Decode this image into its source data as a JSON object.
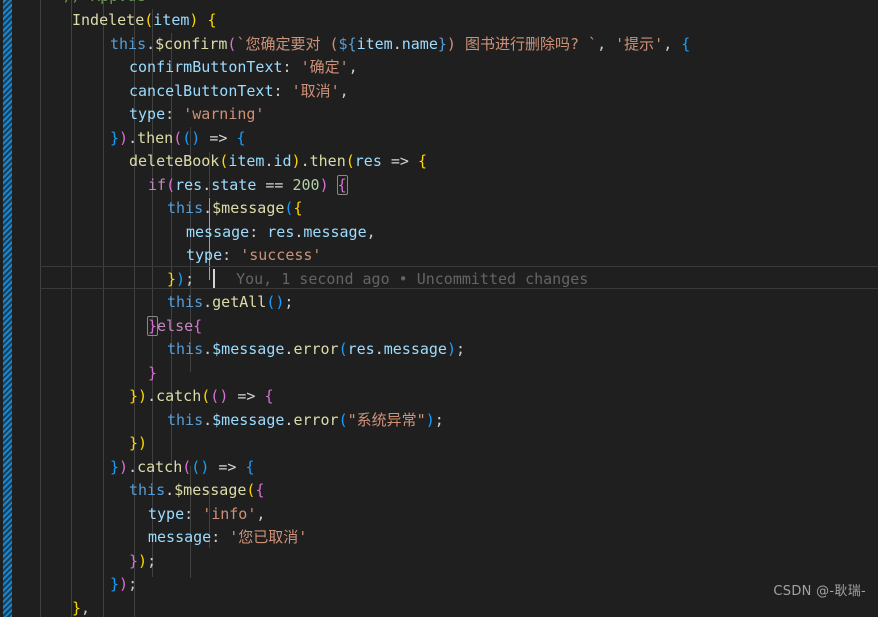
{
  "editor": {
    "app": "code-editor",
    "theme": "dark-plus",
    "language": "javascript",
    "font_size_px": 15,
    "line_height_px": 23.5,
    "colors": {
      "background": "#1f1f1f",
      "foreground": "#cccccc",
      "keyword": "#c586c0",
      "this_keyword": "#569cd6",
      "function": "#dcdcaa",
      "variable": "#9cdcfe",
      "string": "#ce9178",
      "number": "#b5cea8",
      "operator": "#d4d4d4",
      "bracket_level_1": "#ffd700",
      "bracket_level_2": "#da70d6",
      "bracket_level_3": "#179fff",
      "indent_guide": "#404040",
      "indent_guide_active": "#a0a0a0",
      "blame_text": "#6a6a6a",
      "diff_stripe": "#1e8ad6",
      "caret": "#d4d4d4"
    }
  },
  "clipped_top_line": {
    "text": "// AppVue"
  },
  "blame": {
    "text": "You, 1 second ago • Uncommitted changes",
    "author": "You",
    "relative_time": "1 second ago",
    "separator": "•",
    "status": "Uncommitted changes"
  },
  "watermark": {
    "text": "CSDN @-耿瑞-"
  },
  "code_lines": [
    {
      "indent": "    ",
      "text": "Indelete(item) {"
    },
    {
      "indent": "      ",
      "text": "this.$confirm(`您确定要对 (${item.name}) 图书进行删除吗? `, '提示', {"
    },
    {
      "indent": "        ",
      "text": "confirmButtonText: '确定',"
    },
    {
      "indent": "        ",
      "text": "cancelButtonText: '取消',"
    },
    {
      "indent": "        ",
      "text": "type: 'warning'"
    },
    {
      "indent": "      ",
      "text": "}).then(() => {"
    },
    {
      "indent": "        ",
      "text": "deleteBook(item.id).then(res => {"
    },
    {
      "indent": "          ",
      "text": "if(res.state == 200) {"
    },
    {
      "indent": "            ",
      "text": "this.$message({"
    },
    {
      "indent": "              ",
      "text": "message: res.message,"
    },
    {
      "indent": "              ",
      "text": "type: 'success'"
    },
    {
      "indent": "            ",
      "text": "});"
    },
    {
      "indent": "            ",
      "text": "this.getAll();"
    },
    {
      "indent": "          ",
      "text": "}else{"
    },
    {
      "indent": "            ",
      "text": "this.$message.error(res.message);"
    },
    {
      "indent": "          ",
      "text": "}"
    },
    {
      "indent": "        ",
      "text": "}).catch(() => {"
    },
    {
      "indent": "          ",
      "text": "this.$message.error(\"系统异常\");"
    },
    {
      "indent": "        ",
      "text": "})"
    },
    {
      "indent": "      ",
      "text": "}).catch(() => {"
    },
    {
      "indent": "        ",
      "text": "this.$message({"
    },
    {
      "indent": "          ",
      "text": "type: 'info',"
    },
    {
      "indent": "          ",
      "text": "message: '您已取消'"
    },
    {
      "indent": "        ",
      "text": "});"
    },
    {
      "indent": "      ",
      "text": "});"
    },
    {
      "indent": "    ",
      "text": "},"
    }
  ]
}
